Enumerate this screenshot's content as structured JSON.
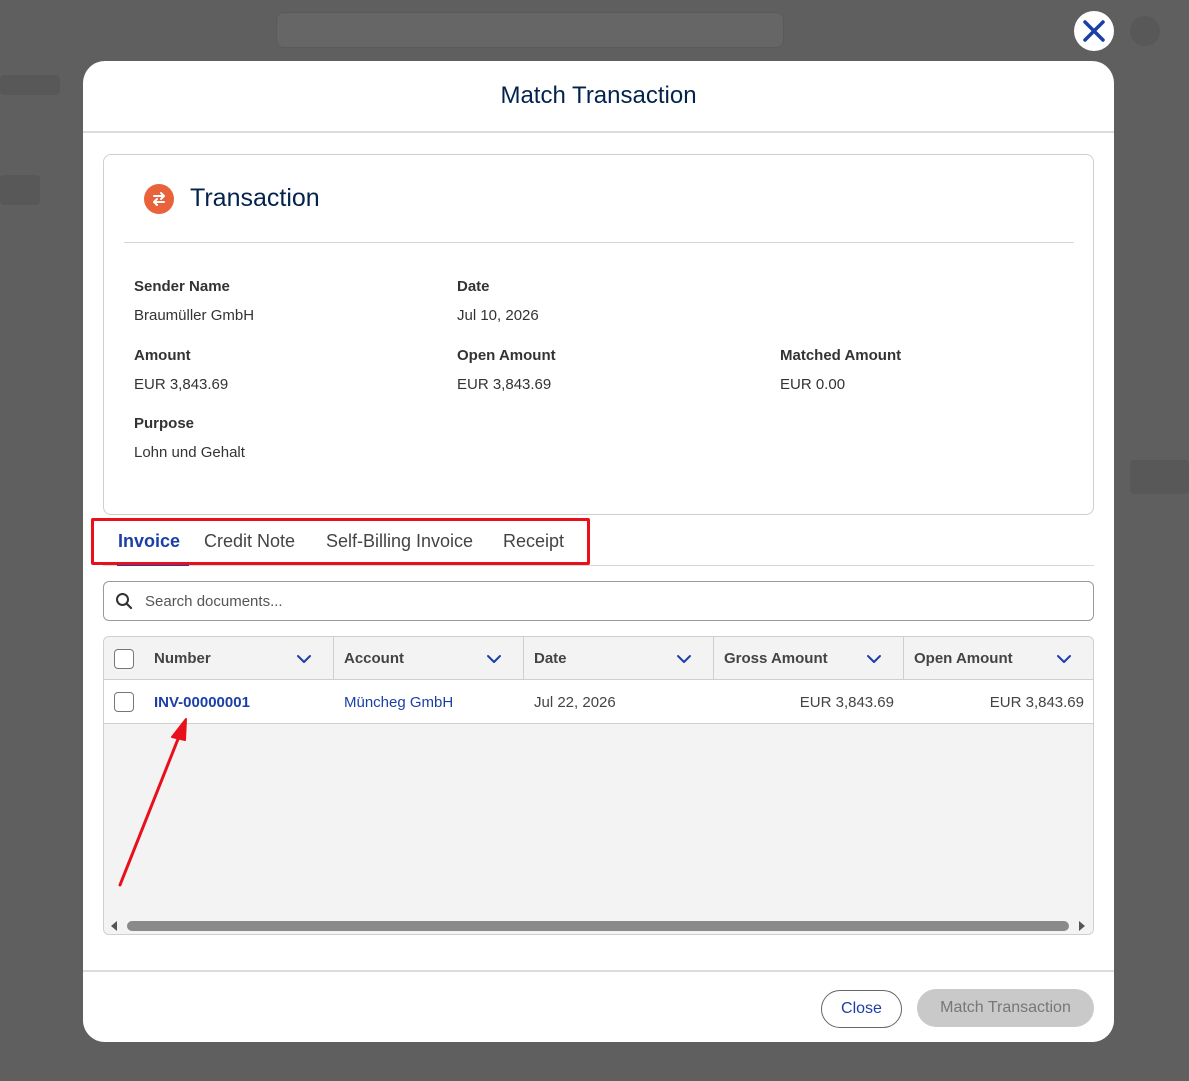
{
  "modal": {
    "title": "Match Transaction"
  },
  "transaction": {
    "title": "Transaction",
    "icon": "exchange-icon",
    "fields": {
      "sender_name_label": "Sender Name",
      "sender_name": "Braumüller GmbH",
      "date_label": "Date",
      "date": "Jul 10, 2026",
      "amount_label": "Amount",
      "amount": "EUR 3,843.69",
      "open_amount_label": "Open Amount",
      "open_amount": "EUR 3,843.69",
      "matched_amount_label": "Matched Amount",
      "matched_amount": "EUR 0.00",
      "purpose_label": "Purpose",
      "purpose": "Lohn und Gehalt"
    }
  },
  "tabs": [
    {
      "label": "Invoice",
      "active": true
    },
    {
      "label": "Credit Note",
      "active": false
    },
    {
      "label": "Self-Billing Invoice",
      "active": false
    },
    {
      "label": "Receipt",
      "active": false
    }
  ],
  "search": {
    "placeholder": "Search documents..."
  },
  "table": {
    "columns": [
      "Number",
      "Account",
      "Date",
      "Gross Amount",
      "Open Amount"
    ],
    "rows": [
      {
        "number": "INV-00000001",
        "account": "Müncheg GmbH",
        "date": "Jul 22, 2026",
        "gross_amount": "EUR 3,843.69",
        "open_amount": "EUR 3,843.69"
      }
    ]
  },
  "footer": {
    "close_label": "Close",
    "match_label": "Match Transaction"
  },
  "colors": {
    "accent": "#1b3fa7",
    "title": "#03234d",
    "transaction_icon": "#e8623b",
    "annotation": "#e8101a"
  }
}
